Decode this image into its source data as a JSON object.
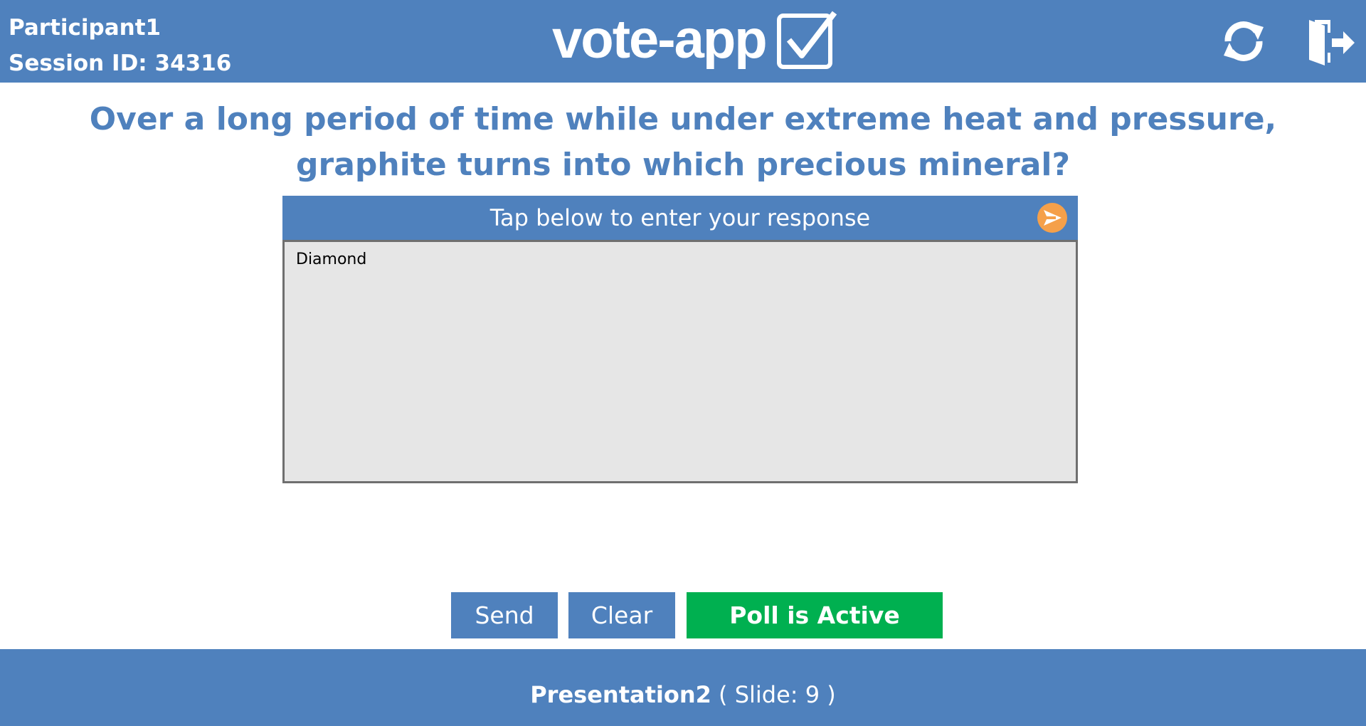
{
  "header": {
    "participant": "Participant1",
    "session": "Session ID: 34316",
    "logo_text": "vote-app",
    "icons": {
      "logo": "checkbox-check-icon",
      "refresh": "refresh-icon",
      "exit": "exit-door-icon"
    }
  },
  "question": {
    "text": "Over a long period of time while under extreme heat and pressure, graphite turns into which precious mineral?"
  },
  "response": {
    "prompt": "Tap below to enter your response",
    "value": "Diamond",
    "submit_icon": "send-arrow-icon"
  },
  "actions": {
    "send_label": "Send",
    "clear_label": "Clear",
    "poll_status": "Poll is Active"
  },
  "footer": {
    "presentation": "Presentation2",
    "slide": "( Slide: 9 )"
  },
  "colors": {
    "primary": "#4f81bd",
    "active": "#00b050",
    "submit": "#f5a04a",
    "response_bg": "#e6e6e6"
  }
}
